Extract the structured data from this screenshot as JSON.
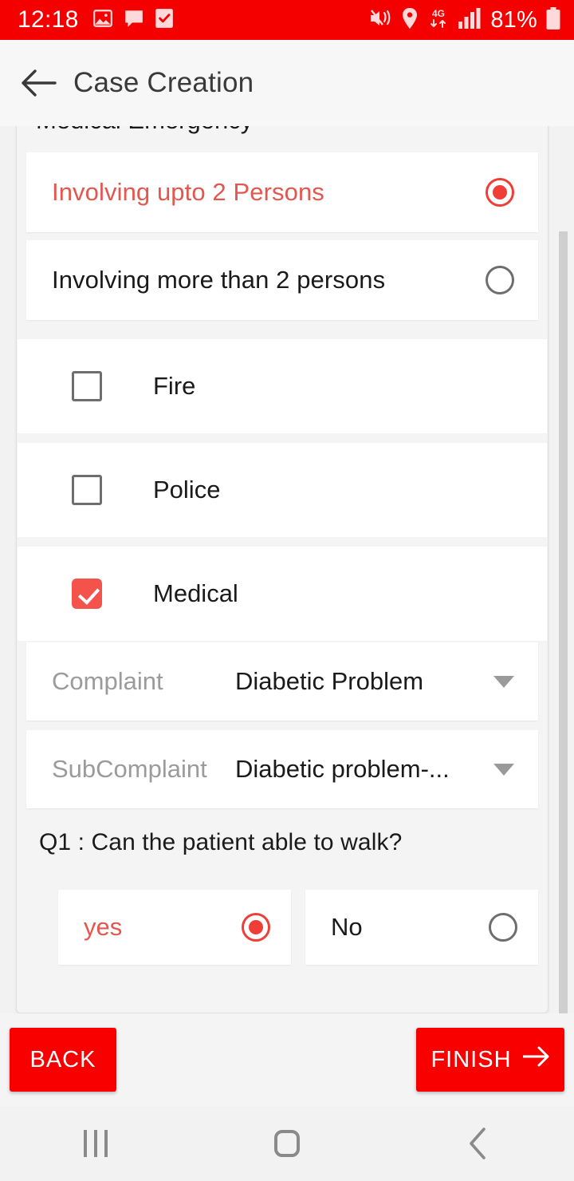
{
  "status_bar": {
    "time": "12:18",
    "battery_percent": "81%",
    "network_type": "4G",
    "left_icons": [
      "image-icon",
      "chat-bubble-icon",
      "task-checkbox-icon"
    ],
    "right_icons": [
      "mute-vibrate-icon",
      "location-pin-icon",
      "mobile-data-4g-icon",
      "signal-bars-icon",
      "battery-icon"
    ],
    "background_color": "#f50000"
  },
  "app_bar": {
    "title": "Case Creation",
    "back_icon": "back-arrow-icon"
  },
  "form": {
    "section_heading": "Medical Emergency",
    "person_count_options": [
      {
        "label": "Involving upto 2 Persons",
        "selected": true
      },
      {
        "label": "Involving more than 2 persons",
        "selected": false
      }
    ],
    "service_checkboxes": [
      {
        "label": "Fire",
        "checked": false
      },
      {
        "label": "Police",
        "checked": false
      },
      {
        "label": "Medical",
        "checked": true
      }
    ],
    "dropdowns": [
      {
        "hint": "Complaint",
        "value": "Diabetic Problem"
      },
      {
        "hint": "SubComplaint",
        "value": "Diabetic problem-..."
      }
    ],
    "question": {
      "text": "Q1 : Can the patient able to walk?",
      "answers": [
        {
          "label": "yes",
          "selected": true
        },
        {
          "label": "No",
          "selected": false
        }
      ]
    }
  },
  "footer": {
    "back_label": "BACK",
    "finish_label": "FINISH",
    "finish_arrow_icon": "arrow-right-icon",
    "button_color": "#f90000"
  },
  "nav_bar": {
    "recents": "recents-icon",
    "home": "home-icon",
    "back": "back-chevron-icon"
  },
  "theme": {
    "accent_red": "#ee3e37",
    "selected_text_red": "#e4574f",
    "status_bar_red": "#f50000"
  }
}
